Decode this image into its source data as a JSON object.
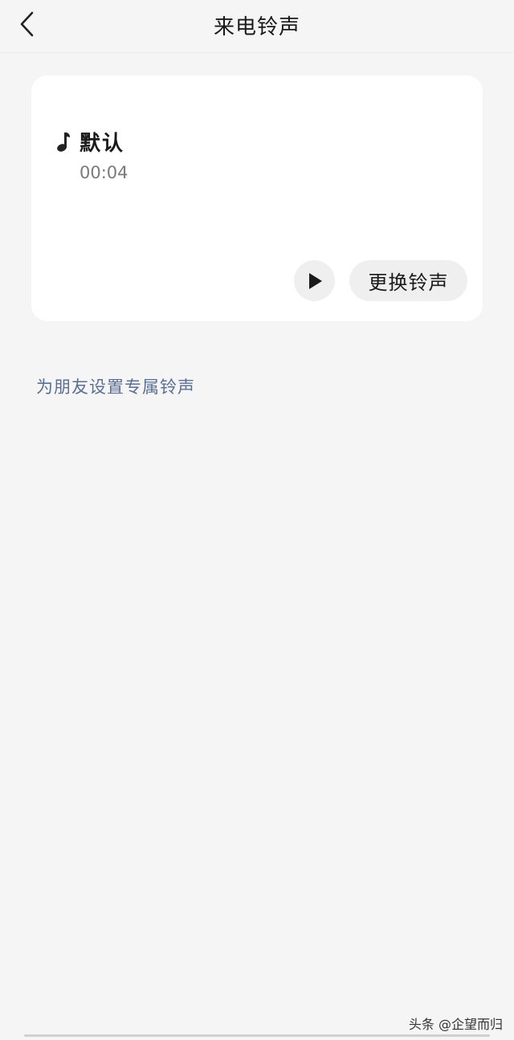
{
  "header": {
    "title": "来电铃声"
  },
  "ringtone": {
    "name": "默认",
    "duration": "00:04",
    "change_label": "更换铃声"
  },
  "friend_link": "为朋友设置专属铃声",
  "watermark": "头条 @企望而归",
  "icons": {
    "back": "chevron-left-icon",
    "note": "music-note-icon",
    "play": "play-icon"
  },
  "colors": {
    "background": "#f5f5f5",
    "card": "#ffffff",
    "link": "#5b6f95",
    "button_bg": "#efefef"
  }
}
